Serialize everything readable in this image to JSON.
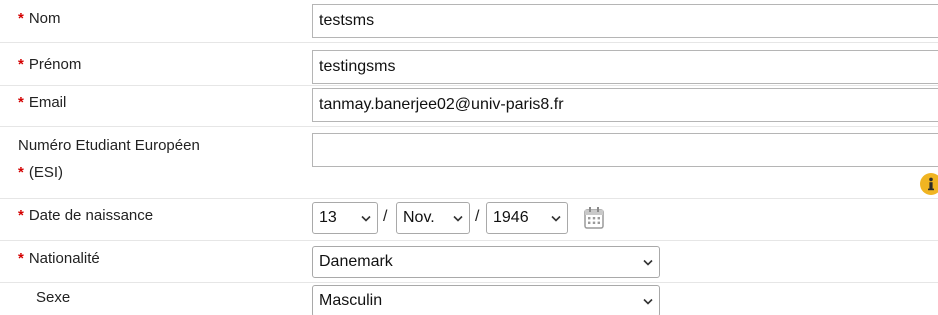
{
  "form": {
    "required_marker": "*",
    "nom": {
      "label": "Nom",
      "value": "testsms"
    },
    "prenom": {
      "label": "Prénom",
      "value": "testingsms"
    },
    "email": {
      "label": "Email",
      "value": "tanmay.banerjee02@univ-paris8.fr"
    },
    "esi": {
      "label_line1": "Numéro Etudiant Européen",
      "label_line2": "(ESI)",
      "value": ""
    },
    "date_naissance": {
      "label": "Date de naissance",
      "day": "13",
      "month": "Nov.",
      "year": "1946",
      "separator": "/"
    },
    "nationalite": {
      "label": "Nationalité",
      "value": "Danemark"
    },
    "sexe": {
      "label": "Sexe",
      "value": "Masculin"
    }
  },
  "icons": {
    "info": "info-icon",
    "calendar": "calendar-icon",
    "chevron": "chevron-down-icon"
  },
  "colors": {
    "required": "#d40000",
    "info_icon": "#f0b422",
    "input_border": "#b5b5b5",
    "row_separator": "#e6e6e6"
  }
}
